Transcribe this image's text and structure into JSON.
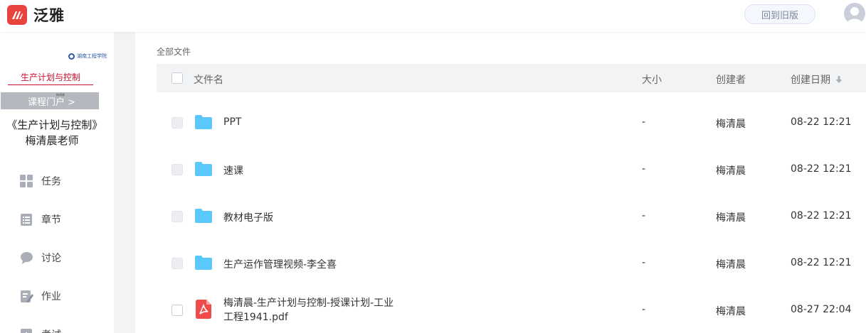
{
  "app": {
    "brand": "泛雅",
    "old_version_button": "回到旧版"
  },
  "course_cover": {
    "school": "湖南工程学院",
    "title": "生产计划与控制",
    "bar_text": "课程门户 >",
    "small_text": "梅清晨"
  },
  "course_name": "《生产计划与控制》梅清晨老师",
  "nav": {
    "task": "任务",
    "chapter": "章节",
    "discussion": "讨论",
    "homework": "作业",
    "exam": "考试"
  },
  "breadcrumb": "全部文件",
  "table": {
    "headers": {
      "name": "文件名",
      "size": "大小",
      "creator": "创建者",
      "date": "创建日期"
    },
    "sort_icon": "arrow-down-icon",
    "rows": [
      {
        "type": "folder",
        "name": "PPT",
        "size": "-",
        "creator": "梅清晨",
        "date": "08-22 12:21"
      },
      {
        "type": "folder",
        "name": "速课",
        "size": "-",
        "creator": "梅清晨",
        "date": "08-22 12:21"
      },
      {
        "type": "folder",
        "name": "教材电子版",
        "size": "-",
        "creator": "梅清晨",
        "date": "08-22 12:21"
      },
      {
        "type": "folder",
        "name": "生产运作管理视频-李全喜",
        "size": "-",
        "creator": "梅清晨",
        "date": "08-22 12:21"
      },
      {
        "type": "pdf",
        "name_line1": "梅清晨-生产计划与控制-授课计划-工业",
        "name_line2": "工程1941.pdf",
        "size": "-",
        "creator": "梅清晨",
        "date": "08-27 22:04"
      }
    ]
  },
  "colors": {
    "accent": "#e8433e",
    "folder": "#5ac8fa",
    "pdf": "#ef4b4b",
    "cover_red": "#c8102e"
  }
}
